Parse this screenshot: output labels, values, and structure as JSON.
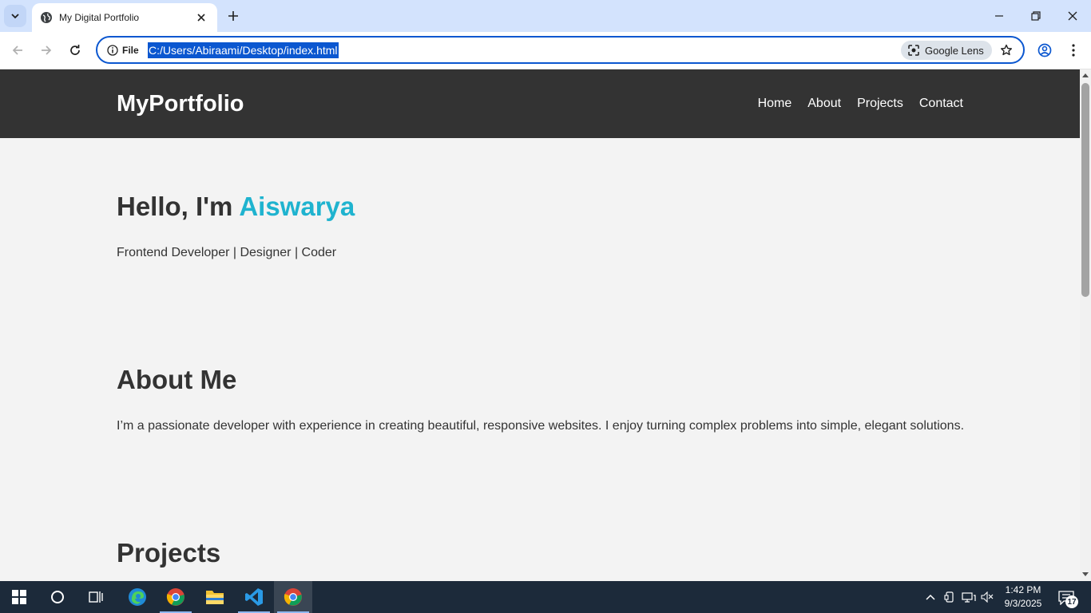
{
  "browser": {
    "tab_title": "My Digital Portfolio",
    "site_chip_label": "File",
    "url": "C:/Users/Abiraami/Desktop/index.html",
    "lens_label": "Google Lens"
  },
  "site": {
    "logo": "MyPortfolio",
    "nav": [
      "Home",
      "About",
      "Projects",
      "Contact"
    ],
    "hero": {
      "greeting": "Hello, I'm ",
      "name": "Aiswarya",
      "subtitle": "Frontend Developer | Designer | Coder"
    },
    "about": {
      "title": "About Me",
      "text": "I’m a passionate developer with experience in creating beautiful, responsive websites. I enjoy turning complex problems into simple, elegant solutions."
    },
    "projects": {
      "title": "Projects"
    }
  },
  "taskbar": {
    "time": "1:42 PM",
    "date": "9/3/2025",
    "notification_count": "17"
  },
  "colors": {
    "header_bg": "#333333",
    "accent": "#1fb3cf",
    "page_bg": "#f3f3f3",
    "taskbar_bg": "#1c2a3a"
  }
}
